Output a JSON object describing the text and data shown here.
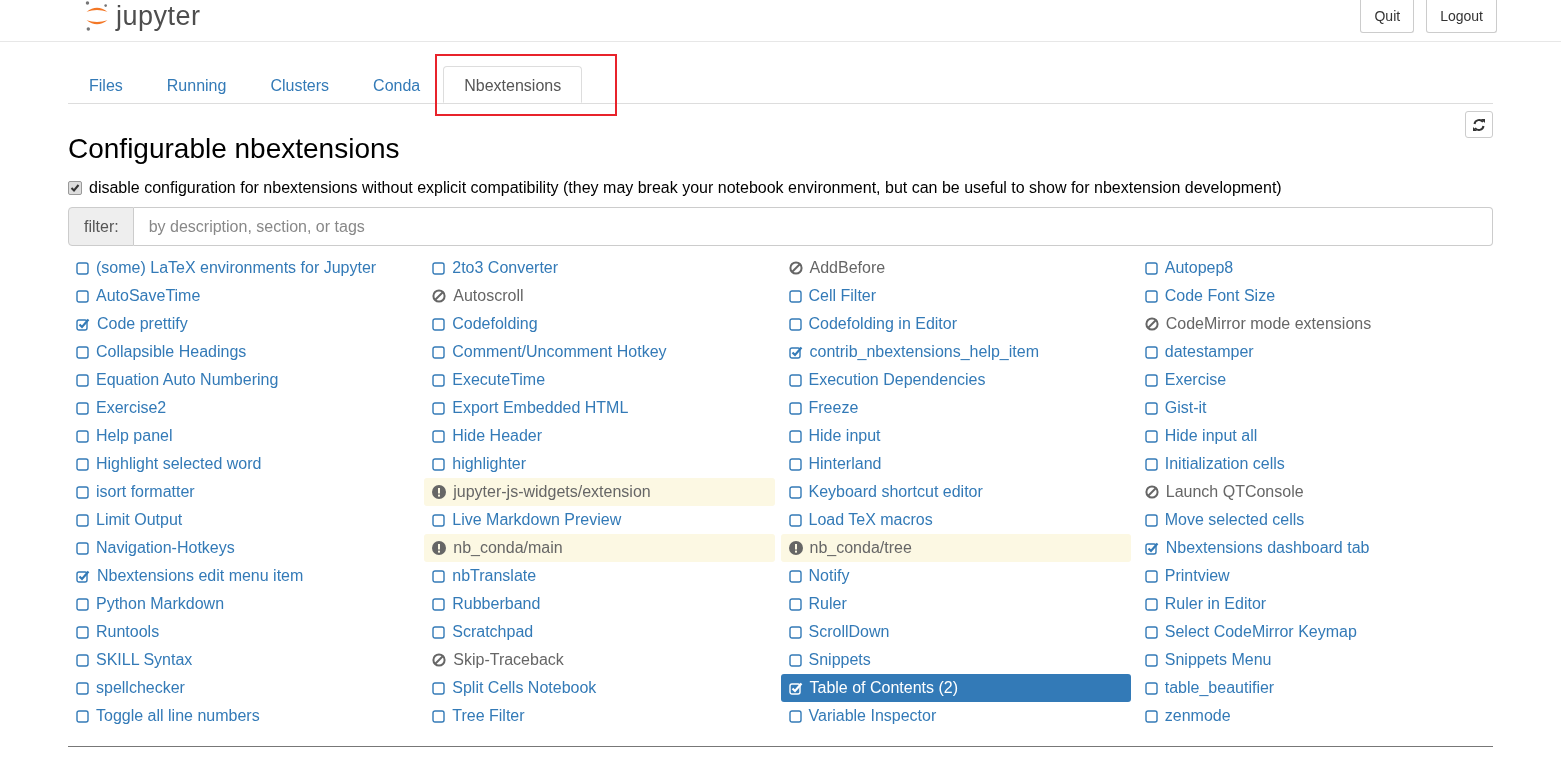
{
  "header": {
    "logo_text": "jupyter",
    "buttons": [
      "Quit",
      "Logout"
    ]
  },
  "tabs": [
    {
      "label": "Files",
      "selected": false
    },
    {
      "label": "Running",
      "selected": false
    },
    {
      "label": "Clusters",
      "selected": false
    },
    {
      "label": "Conda",
      "selected": false
    },
    {
      "label": "Nbextensions",
      "selected": true
    }
  ],
  "heading": "Configurable nbextensions",
  "compat_option": {
    "label": "disable configuration for nbextensions without explicit compatibility (they may break your notebook environment, but can be useful to show for nbextension development)",
    "checked": true
  },
  "filter": {
    "label": "filter:",
    "placeholder": "by description, section, or tags"
  },
  "extensions": [
    {
      "name": "(some) LaTeX environments for Jupyter",
      "kind": "unchecked",
      "selected": false
    },
    {
      "name": "2to3 Converter",
      "kind": "unchecked",
      "selected": false
    },
    {
      "name": "AddBefore",
      "kind": "disabled",
      "selected": false
    },
    {
      "name": "Autopep8",
      "kind": "unchecked",
      "selected": false
    },
    {
      "name": "AutoSaveTime",
      "kind": "unchecked",
      "selected": false
    },
    {
      "name": "Autoscroll",
      "kind": "disabled",
      "selected": false
    },
    {
      "name": "Cell Filter",
      "kind": "unchecked",
      "selected": false
    },
    {
      "name": "Code Font Size",
      "kind": "unchecked",
      "selected": false
    },
    {
      "name": "Code prettify",
      "kind": "checked",
      "selected": false
    },
    {
      "name": "Codefolding",
      "kind": "unchecked",
      "selected": false
    },
    {
      "name": "Codefolding in Editor",
      "kind": "unchecked",
      "selected": false
    },
    {
      "name": "CodeMirror mode extensions",
      "kind": "disabled",
      "selected": false
    },
    {
      "name": "Collapsible Headings",
      "kind": "unchecked",
      "selected": false
    },
    {
      "name": "Comment/Uncomment Hotkey",
      "kind": "unchecked",
      "selected": false
    },
    {
      "name": "contrib_nbextensions_help_item",
      "kind": "checked",
      "selected": false
    },
    {
      "name": "datestamper",
      "kind": "unchecked",
      "selected": false
    },
    {
      "name": "Equation Auto Numbering",
      "kind": "unchecked",
      "selected": false
    },
    {
      "name": "ExecuteTime",
      "kind": "unchecked",
      "selected": false
    },
    {
      "name": "Execution Dependencies",
      "kind": "unchecked",
      "selected": false
    },
    {
      "name": "Exercise",
      "kind": "unchecked",
      "selected": false
    },
    {
      "name": "Exercise2",
      "kind": "unchecked",
      "selected": false
    },
    {
      "name": "Export Embedded HTML",
      "kind": "unchecked",
      "selected": false
    },
    {
      "name": "Freeze",
      "kind": "unchecked",
      "selected": false
    },
    {
      "name": "Gist-it",
      "kind": "unchecked",
      "selected": false
    },
    {
      "name": "Help panel",
      "kind": "unchecked",
      "selected": false
    },
    {
      "name": "Hide Header",
      "kind": "unchecked",
      "selected": false
    },
    {
      "name": "Hide input",
      "kind": "unchecked",
      "selected": false
    },
    {
      "name": "Hide input all",
      "kind": "unchecked",
      "selected": false
    },
    {
      "name": "Highlight selected word",
      "kind": "unchecked",
      "selected": false
    },
    {
      "name": "highlighter",
      "kind": "unchecked",
      "selected": false
    },
    {
      "name": "Hinterland",
      "kind": "unchecked",
      "selected": false
    },
    {
      "name": "Initialization cells",
      "kind": "unchecked",
      "selected": false
    },
    {
      "name": "isort formatter",
      "kind": "unchecked",
      "selected": false
    },
    {
      "name": "jupyter-js-widgets/extension",
      "kind": "warning",
      "selected": false
    },
    {
      "name": "Keyboard shortcut editor",
      "kind": "unchecked",
      "selected": false
    },
    {
      "name": "Launch QTConsole",
      "kind": "disabled",
      "selected": false
    },
    {
      "name": "Limit Output",
      "kind": "unchecked",
      "selected": false
    },
    {
      "name": "Live Markdown Preview",
      "kind": "unchecked",
      "selected": false
    },
    {
      "name": "Load TeX macros",
      "kind": "unchecked",
      "selected": false
    },
    {
      "name": "Move selected cells",
      "kind": "unchecked",
      "selected": false
    },
    {
      "name": "Navigation-Hotkeys",
      "kind": "unchecked",
      "selected": false
    },
    {
      "name": "nb_conda/main",
      "kind": "warning",
      "selected": false
    },
    {
      "name": "nb_conda/tree",
      "kind": "warning",
      "selected": false
    },
    {
      "name": "Nbextensions dashboard tab",
      "kind": "checked",
      "selected": false
    },
    {
      "name": "Nbextensions edit menu item",
      "kind": "checked",
      "selected": false
    },
    {
      "name": "nbTranslate",
      "kind": "unchecked",
      "selected": false
    },
    {
      "name": "Notify",
      "kind": "unchecked",
      "selected": false
    },
    {
      "name": "Printview",
      "kind": "unchecked",
      "selected": false
    },
    {
      "name": "Python Markdown",
      "kind": "unchecked",
      "selected": false
    },
    {
      "name": "Rubberband",
      "kind": "unchecked",
      "selected": false
    },
    {
      "name": "Ruler",
      "kind": "unchecked",
      "selected": false
    },
    {
      "name": "Ruler in Editor",
      "kind": "unchecked",
      "selected": false
    },
    {
      "name": "Runtools",
      "kind": "unchecked",
      "selected": false
    },
    {
      "name": "Scratchpad",
      "kind": "unchecked",
      "selected": false
    },
    {
      "name": "ScrollDown",
      "kind": "unchecked",
      "selected": false
    },
    {
      "name": "Select CodeMirror Keymap",
      "kind": "unchecked",
      "selected": false
    },
    {
      "name": "SKILL Syntax",
      "kind": "unchecked",
      "selected": false
    },
    {
      "name": "Skip-Traceback",
      "kind": "disabled",
      "selected": false
    },
    {
      "name": "Snippets",
      "kind": "unchecked",
      "selected": false
    },
    {
      "name": "Snippets Menu",
      "kind": "unchecked",
      "selected": false
    },
    {
      "name": "spellchecker",
      "kind": "unchecked",
      "selected": false
    },
    {
      "name": "Split Cells Notebook",
      "kind": "unchecked",
      "selected": false
    },
    {
      "name": "Table of Contents (2)",
      "kind": "checked",
      "selected": true
    },
    {
      "name": "table_beautifier",
      "kind": "unchecked",
      "selected": false
    },
    {
      "name": "Toggle all line numbers",
      "kind": "unchecked",
      "selected": false
    },
    {
      "name": "Tree Filter",
      "kind": "unchecked",
      "selected": false
    },
    {
      "name": "Variable Inspector",
      "kind": "unchecked",
      "selected": false
    },
    {
      "name": "zenmode",
      "kind": "unchecked",
      "selected": false
    }
  ]
}
